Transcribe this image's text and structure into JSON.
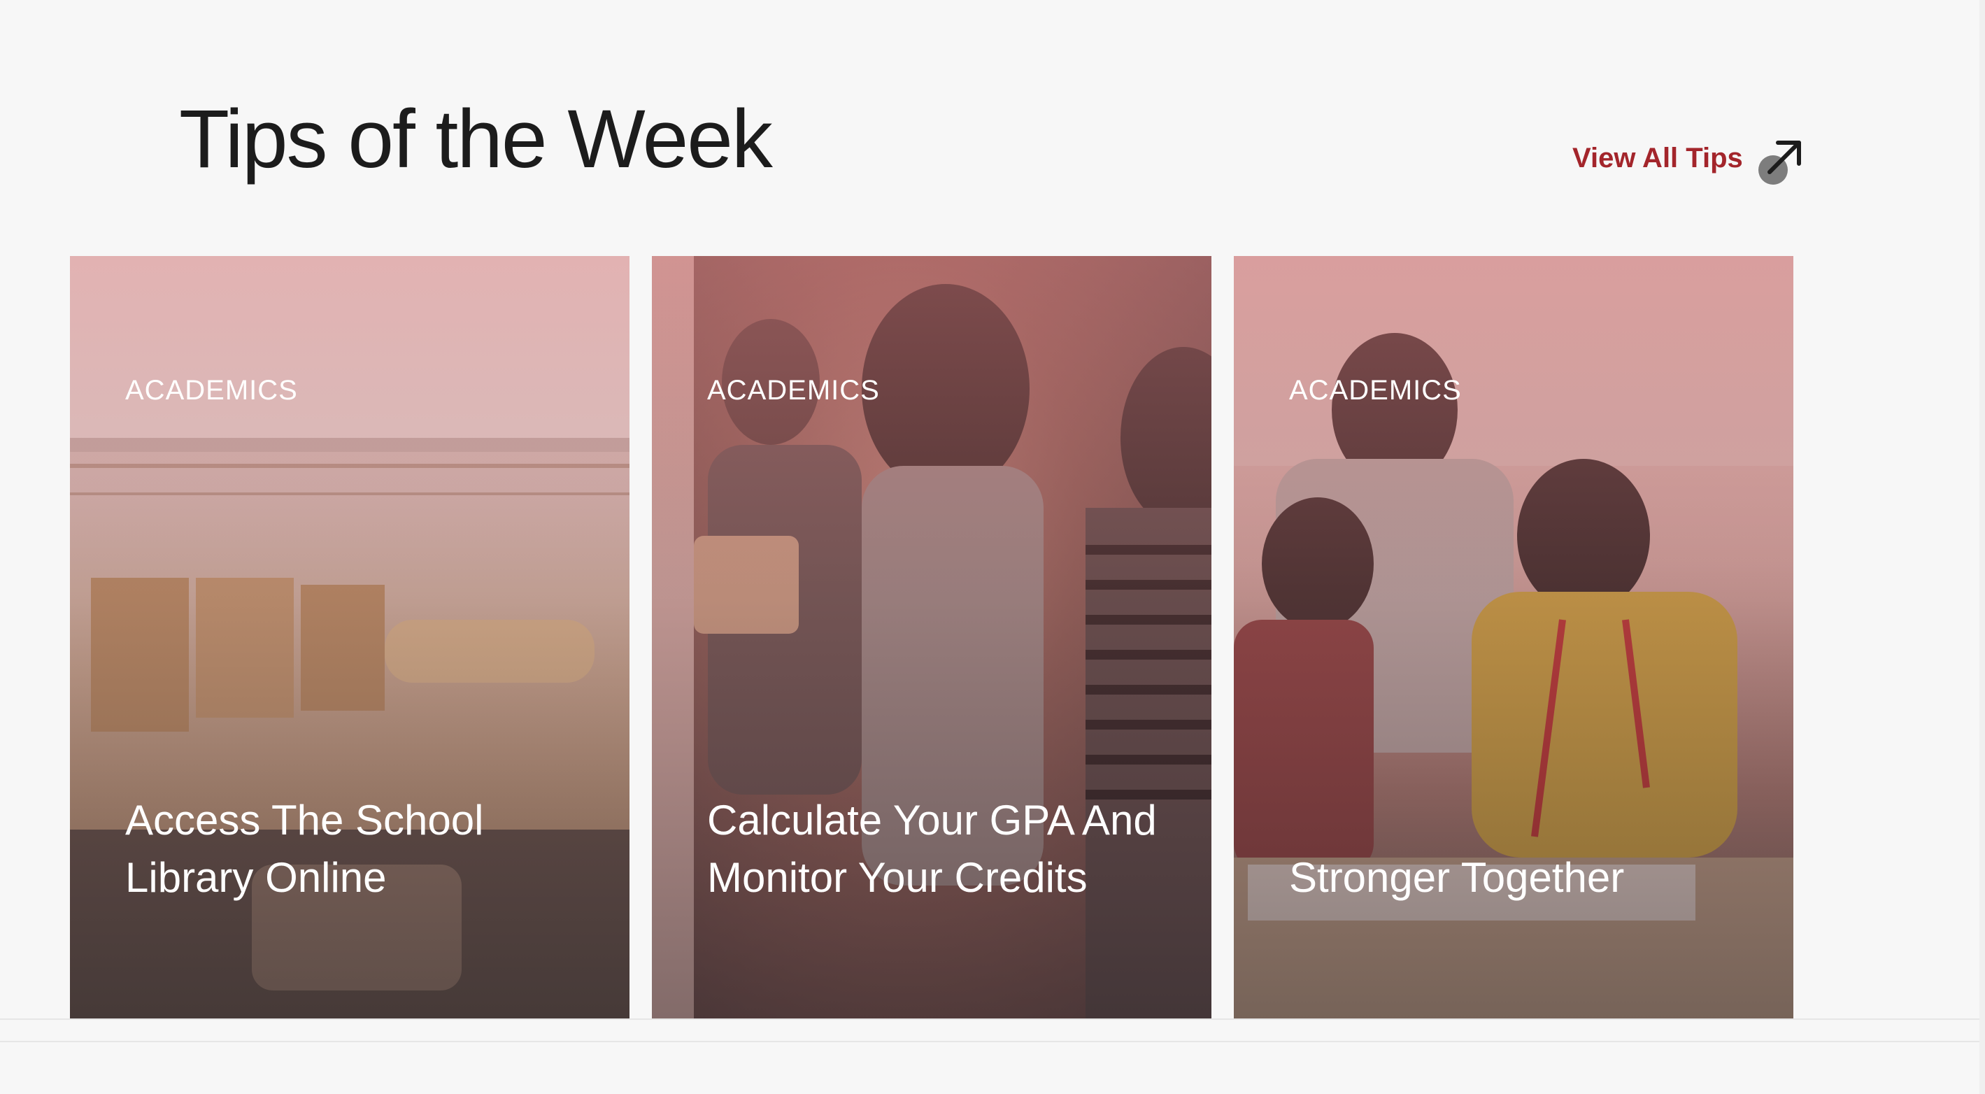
{
  "header": {
    "title": "Tips of the Week",
    "view_all_label": "View All Tips",
    "view_all_icon": "arrow-up-right-icon"
  },
  "colors": {
    "accent": "#a3252b",
    "background": "#f7f7f7",
    "title": "#1c1c1c"
  },
  "cards": [
    {
      "category": "ACADEMICS",
      "title": "Access The School Library Online",
      "image": "library-photo"
    },
    {
      "category": "ACADEMICS",
      "title": "Calculate Your GPA And Monitor Your Credits",
      "image": "students-laughing-photo"
    },
    {
      "category": "ACADEMICS",
      "title": "Stronger Together",
      "image": "students-group-study-photo"
    }
  ]
}
